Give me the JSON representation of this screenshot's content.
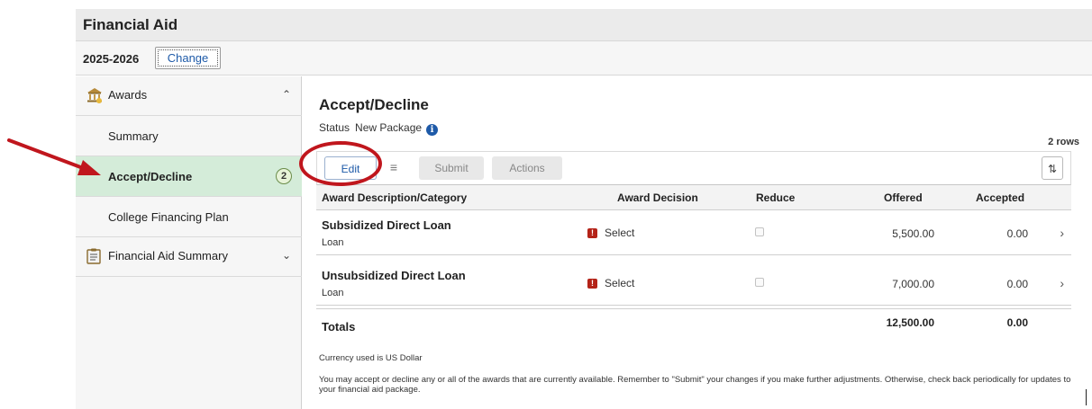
{
  "header": {
    "title": "Financial Aid"
  },
  "year_bar": {
    "year": "2025-2026",
    "change_label": "Change"
  },
  "sidebar": {
    "awards_label": "Awards",
    "awards_expanded": true,
    "items": [
      {
        "label": "Summary",
        "active": false
      },
      {
        "label": "Accept/Decline",
        "active": true,
        "badge": "2"
      },
      {
        "label": "College Financing Plan",
        "active": false
      }
    ],
    "fa_summary_label": "Financial Aid Summary",
    "fa_summary_expanded": false
  },
  "main": {
    "title": "Accept/Decline",
    "status_label": "Status",
    "status_value": "New Package",
    "row_count": "2 rows",
    "toolbar": {
      "edit_label": "Edit",
      "submit_label": "Submit",
      "actions_label": "Actions"
    },
    "columns": [
      "Award Description/Category",
      "Award Decision",
      "Reduce",
      "Offered",
      "Accepted"
    ],
    "rows": [
      {
        "name": "Subsidized Direct Loan",
        "category": "Loan",
        "decision": "Select",
        "offered": "5,500.00",
        "accepted": "0.00"
      },
      {
        "name": "Unsubsidized Direct Loan",
        "category": "Loan",
        "decision": "Select",
        "offered": "7,000.00",
        "accepted": "0.00"
      }
    ],
    "totals": {
      "label": "Totals",
      "offered": "12,500.00",
      "accepted": "0.00"
    },
    "currency_note": "Currency used is US Dollar",
    "instruction_note": "You may accept or decline any or all of the awards that are currently available. Remember to \"Submit\" your changes if you make further adjustments. Otherwise, check back periodically for updates to your financial aid package."
  },
  "colors": {
    "active_bg": "#d4ecd9",
    "annotation_red": "#c0161d",
    "link_blue": "#1e5aa8"
  }
}
